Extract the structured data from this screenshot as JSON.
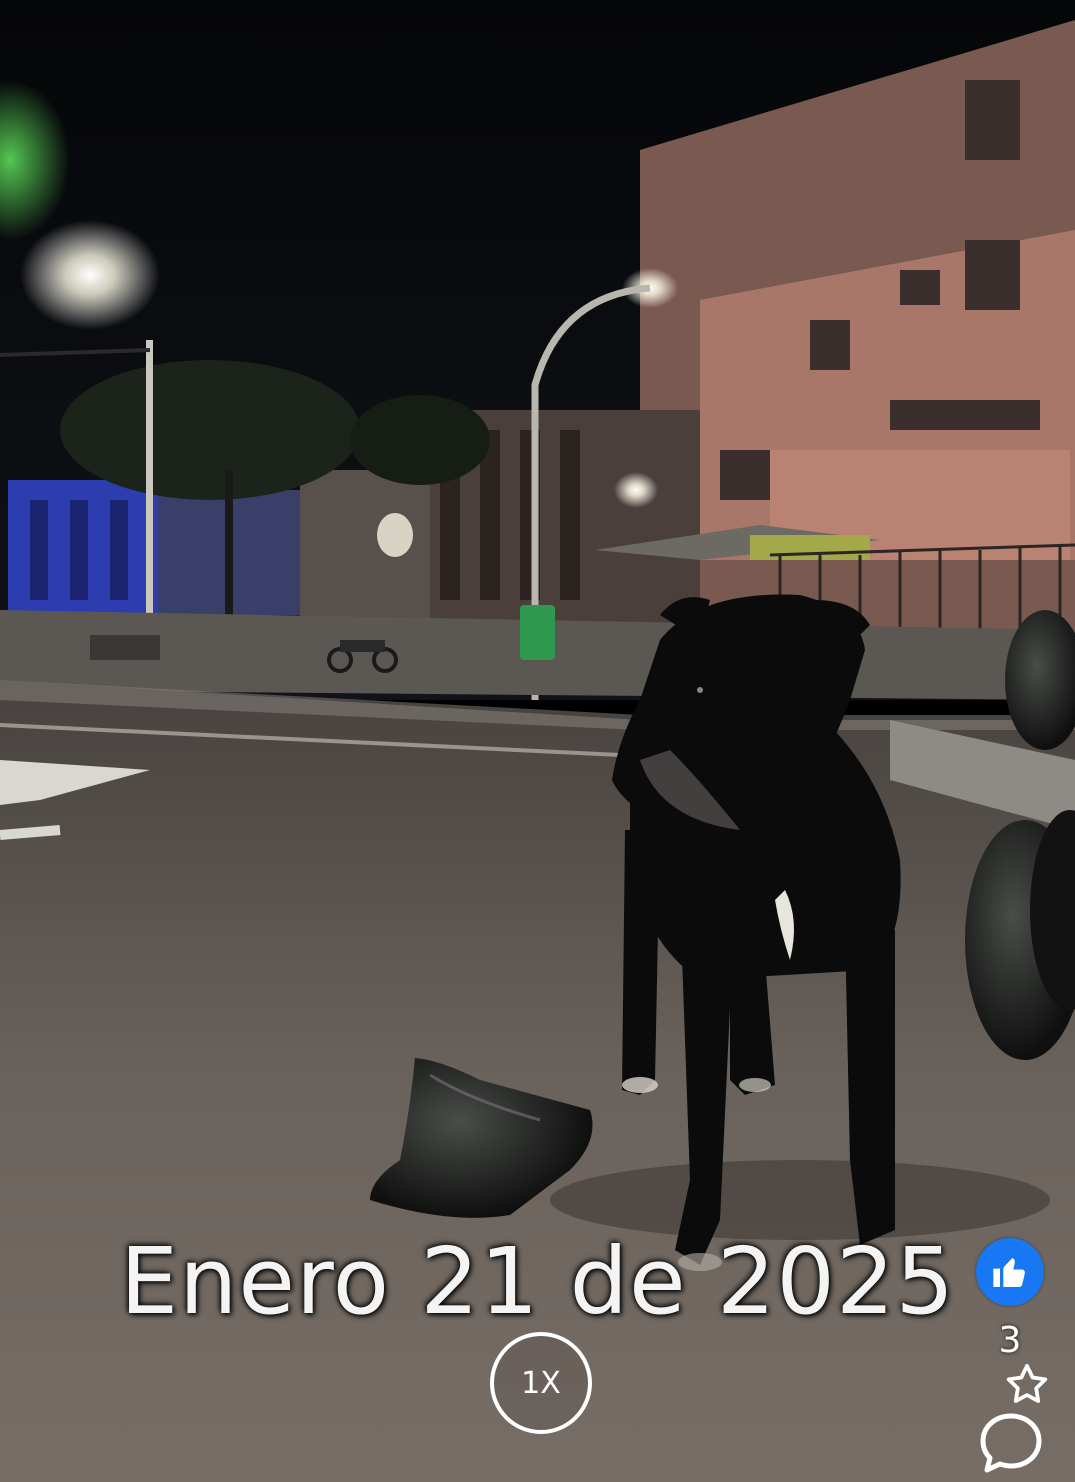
{
  "video": {
    "caption": "Enero 21 de 2025",
    "speed_label": "1X"
  },
  "actions": {
    "like_icon": "thumbs-up-icon",
    "like_count": "3",
    "star_icon": "star-outline-icon",
    "comment_icon": "comment-bubble-icon"
  },
  "colors": {
    "like_accent": "#1877f2"
  }
}
